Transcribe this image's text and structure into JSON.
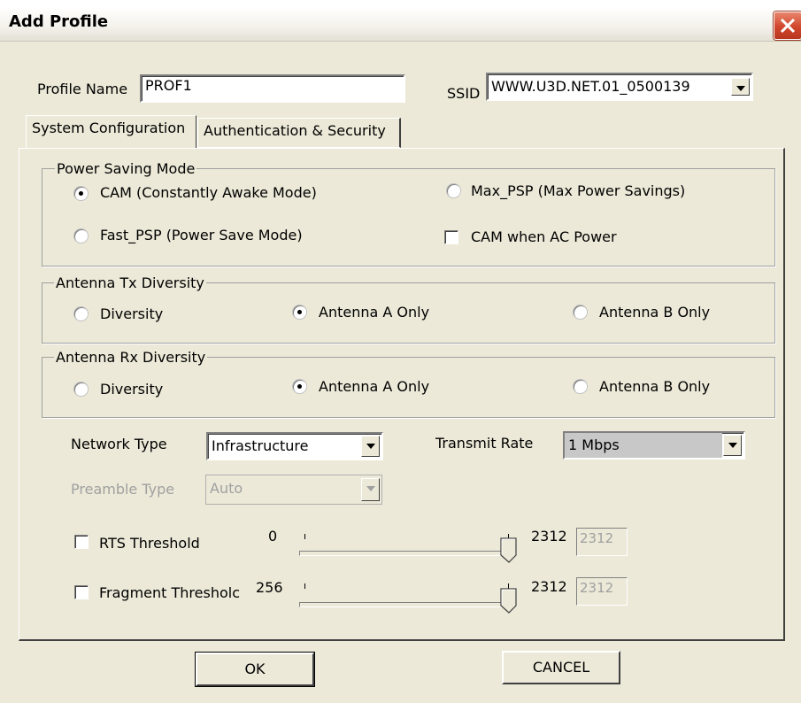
{
  "window": {
    "title": "Add Profile"
  },
  "profile": {
    "name_label": "Profile Name",
    "name_value": "PROF1",
    "ssid_label": "SSID",
    "ssid_value": "WWW.U3D.NET.01_0500139"
  },
  "tabs": [
    {
      "label": "System Configuration",
      "active": true
    },
    {
      "label": "Authentication & Security",
      "active": false
    }
  ],
  "power_saving": {
    "legend": "Power Saving Mode",
    "options": [
      {
        "label": "CAM (Constantly Awake Mode)",
        "selected": true
      },
      {
        "label": "Max_PSP (Max Power Savings)",
        "selected": false
      },
      {
        "label": "Fast_PSP (Power Save Mode)",
        "selected": false
      }
    ],
    "cam_ac_label": "CAM when AC Power",
    "cam_ac_checked": false
  },
  "tx_diversity": {
    "legend": "Antenna Tx Diversity",
    "options": [
      {
        "label": "Diversity",
        "selected": false
      },
      {
        "label": "Antenna A Only",
        "selected": true
      },
      {
        "label": "Antenna B Only",
        "selected": false
      }
    ]
  },
  "rx_diversity": {
    "legend": "Antenna Rx Diversity",
    "options": [
      {
        "label": "Diversity",
        "selected": false
      },
      {
        "label": "Antenna A Only",
        "selected": true
      },
      {
        "label": "Antenna B Only",
        "selected": false
      }
    ]
  },
  "network": {
    "type_label": "Network Type",
    "type_value": "Infrastructure",
    "rate_label": "Transmit Rate",
    "rate_value": "1 Mbps",
    "preamble_label": "Preamble Type",
    "preamble_value": "Auto"
  },
  "rts": {
    "label": "RTS Threshold",
    "checked": false,
    "min": "0",
    "max": "2312",
    "value": "2312"
  },
  "fragment": {
    "label": "Fragment Thresholc",
    "checked": false,
    "min": "256",
    "max": "2312",
    "value": "2312"
  },
  "buttons": {
    "ok": "OK",
    "cancel": "CANCEL"
  },
  "colors": {
    "dialog_bg": "#ece9d8",
    "close_button": "#d0462c",
    "selected_combo": "#c8c8c8"
  }
}
